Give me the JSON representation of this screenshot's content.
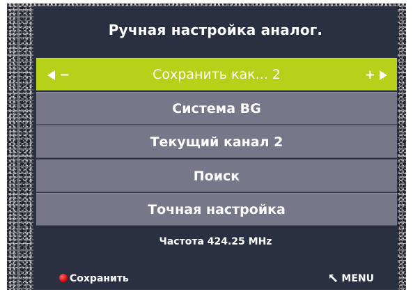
{
  "title": "Ручная настройка аналог.",
  "items": [
    {
      "label": "Сохранить как... 2",
      "left_symbol": "−",
      "right_symbol": "+"
    },
    {
      "label": "Система BG"
    },
    {
      "label": "Текущий канал 2"
    },
    {
      "label": "Поиск"
    },
    {
      "label": "Точная настройка"
    }
  ],
  "frequency": "Частота 424.25 MHz",
  "footer": {
    "save_label": "Сохранить",
    "menu_label": "MENU"
  },
  "colors": {
    "panel": "#2b2f42",
    "item": "#76788a",
    "selected": "#b7d01a",
    "save_dot": "#d00000"
  }
}
